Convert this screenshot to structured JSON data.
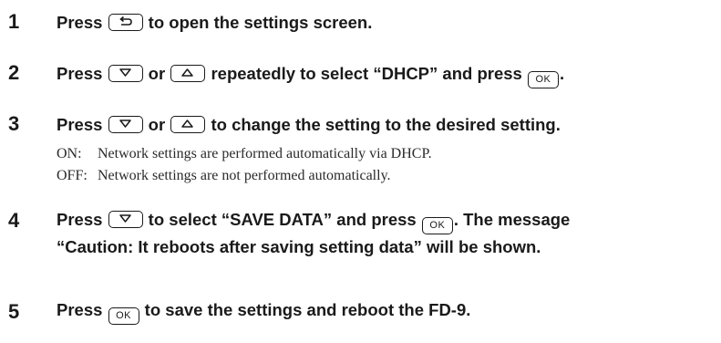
{
  "steps": [
    {
      "number": "1",
      "parts": [
        "Press ",
        " to open the settings screen."
      ],
      "keys": [
        "back-key"
      ]
    },
    {
      "number": "2",
      "parts": [
        "Press ",
        " or ",
        " repeatedly to select “DHCP” and press ",
        "."
      ],
      "keys": [
        "down-key",
        "up-key",
        "ok-key"
      ]
    },
    {
      "number": "3",
      "parts": [
        "Press ",
        " or ",
        " to change the setting to the desired setting."
      ],
      "keys": [
        "down-key",
        "up-key"
      ],
      "options": [
        {
          "name": "ON:",
          "desc": "Network settings are performed automatically via DHCP."
        },
        {
          "name": "OFF:",
          "desc": "Network settings are not performed automatically."
        }
      ]
    },
    {
      "number": "4",
      "parts": [
        "Press ",
        " to select “SAVE DATA” and press ",
        ". The message"
      ],
      "line2": "“Caution: It reboots after saving setting data” will be shown.",
      "keys": [
        "down-key",
        "ok-key"
      ]
    },
    {
      "number": "5",
      "parts": [
        "Press ",
        " to save the settings and reboot the FD-9."
      ],
      "keys": [
        "ok-key"
      ]
    }
  ],
  "key_labels": {
    "ok": "OK"
  }
}
